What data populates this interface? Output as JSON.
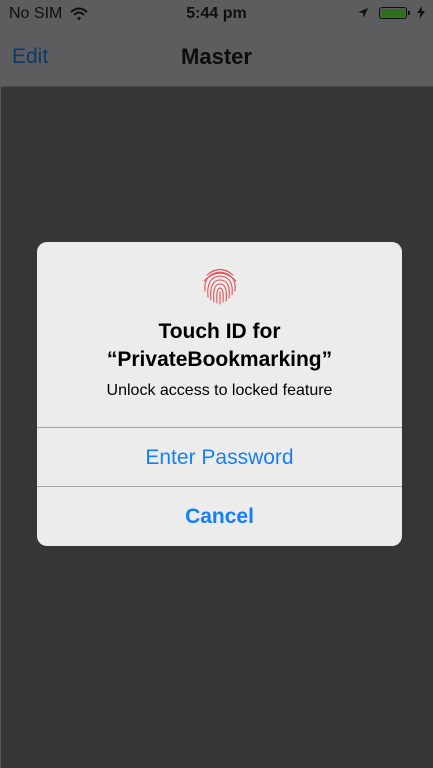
{
  "status_bar": {
    "carrier": "No SIM",
    "time": "5:44 pm",
    "icons": [
      "wifi-icon",
      "location-arrow-icon",
      "battery-icon",
      "charging-bolt-icon"
    ],
    "battery_color": "#2f6e1d"
  },
  "nav": {
    "edit_label": "Edit",
    "title": "Master"
  },
  "alert": {
    "icon": "fingerprint-icon",
    "icon_color": "#e0535a",
    "title_line1": "Touch ID for",
    "title_line2": "“PrivateBookmarking”",
    "message": "Unlock access to locked feature",
    "enter_password_label": "Enter Password",
    "cancel_label": "Cancel",
    "button_color": "#157efb"
  }
}
